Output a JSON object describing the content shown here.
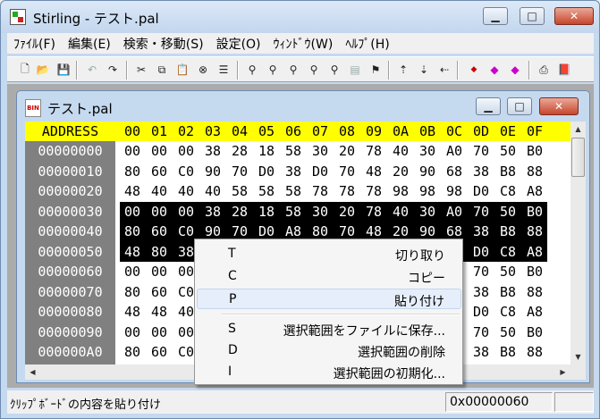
{
  "app": {
    "title": "Stirling - テスト.pal"
  },
  "menu": [
    "ﾌｧｲﾙ(F)",
    "編集(E)",
    "検索・移動(S)",
    "設定(O)",
    "ｳｨﾝﾄﾞｳ(W)",
    "ﾍﾙﾌﾟ(H)"
  ],
  "window_controls": {
    "minimize": "▁",
    "maximize": "□",
    "close": "✕"
  },
  "toolbar_icons": [
    "new-file-icon",
    "open-file-icon",
    "save-icon",
    "undo-icon",
    "redo-icon",
    "cut-icon",
    "copy-icon",
    "paste-icon",
    "delete-icon",
    "select-block-icon",
    "find-icon",
    "find-next-icon",
    "find-down-icon",
    "find-up-icon",
    "find-replace-icon",
    "compare-icon",
    "jump-icon",
    "address-jump-icon",
    "down-jump-icon",
    "back-jump-icon",
    "mark-icon",
    "mark-prev-icon",
    "mark-next-icon",
    "print-icon",
    "info-icon"
  ],
  "document": {
    "title": "テスト.pal",
    "icon_text": "BIN",
    "header": {
      "address_label": "ADDRESS",
      "columns": [
        "00",
        "01",
        "02",
        "03",
        "04",
        "05",
        "06",
        "07",
        "08",
        "09",
        "0A",
        "0B",
        "0C",
        "0D",
        "0E",
        "0F"
      ]
    },
    "rows": [
      {
        "address": "00000000",
        "bytes": [
          "00",
          "00",
          "00",
          "38",
          "28",
          "18",
          "58",
          "30",
          "20",
          "78",
          "40",
          "30",
          "A0",
          "70",
          "50",
          "B0"
        ]
      },
      {
        "address": "00000010",
        "bytes": [
          "80",
          "60",
          "C0",
          "90",
          "70",
          "D0",
          "38",
          "D0",
          "70",
          "48",
          "20",
          "90",
          "68",
          "38",
          "B8",
          "88"
        ]
      },
      {
        "address": "00000020",
        "bytes": [
          "48",
          "40",
          "40",
          "40",
          "58",
          "58",
          "58",
          "78",
          "78",
          "78",
          "98",
          "98",
          "98",
          "D0",
          "C8",
          "A8"
        ]
      },
      {
        "address": "00000030",
        "bytes": [
          "00",
          "00",
          "00",
          "38",
          "28",
          "18",
          "58",
          "30",
          "20",
          "78",
          "40",
          "30",
          "A0",
          "70",
          "50",
          "B0"
        ]
      },
      {
        "address": "00000040",
        "bytes": [
          "80",
          "60",
          "C0",
          "90",
          "70",
          "D0",
          "A8",
          "80",
          "70",
          "48",
          "20",
          "90",
          "68",
          "38",
          "B8",
          "88"
        ]
      },
      {
        "address": "00000050",
        "bytes": [
          "48",
          "80",
          "38",
          "",
          "",
          "",
          "",
          "",
          "",
          "",
          "",
          "",
          "",
          "D0",
          "C8",
          "A8"
        ]
      },
      {
        "address": "00000060",
        "bytes": [
          "00",
          "00",
          "00",
          "",
          "",
          "",
          "",
          "",
          "",
          "",
          "",
          "",
          "",
          "70",
          "50",
          "B0"
        ]
      },
      {
        "address": "00000070",
        "bytes": [
          "80",
          "60",
          "C0",
          "",
          "",
          "",
          "",
          "",
          "",
          "",
          "",
          "",
          "",
          "38",
          "B8",
          "88"
        ]
      },
      {
        "address": "00000080",
        "bytes": [
          "48",
          "48",
          "40",
          "",
          "",
          "",
          "",
          "",
          "",
          "",
          "",
          "",
          "",
          "D0",
          "C8",
          "A8"
        ]
      },
      {
        "address": "00000090",
        "bytes": [
          "00",
          "00",
          "00",
          "",
          "",
          "",
          "",
          "",
          "",
          "",
          "",
          "",
          "",
          "70",
          "50",
          "B0"
        ]
      },
      {
        "address": "000000A0",
        "bytes": [
          "80",
          "60",
          "C0",
          "",
          "",
          "",
          "",
          "",
          "",
          "",
          "",
          "",
          "",
          "38",
          "B8",
          "88"
        ]
      }
    ]
  },
  "context_menu": [
    {
      "key": "T",
      "label": "切り取り"
    },
    {
      "key": "C",
      "label": "コピー"
    },
    {
      "key": "P",
      "label": "貼り付け"
    },
    {
      "key": "S",
      "label": "選択範囲をファイルに保存..."
    },
    {
      "key": "D",
      "label": "選択範囲の削除"
    },
    {
      "key": "I",
      "label": "選択範囲の初期化..."
    }
  ],
  "status": {
    "message": "ｸﾘｯﾌﾟﾎﾞｰﾄﾞの内容を貼り付け",
    "offset": "0x00000060"
  },
  "colors": {
    "header_bg": "#ffff00",
    "address_bg": "#808080",
    "selection_bg": "#000000"
  }
}
